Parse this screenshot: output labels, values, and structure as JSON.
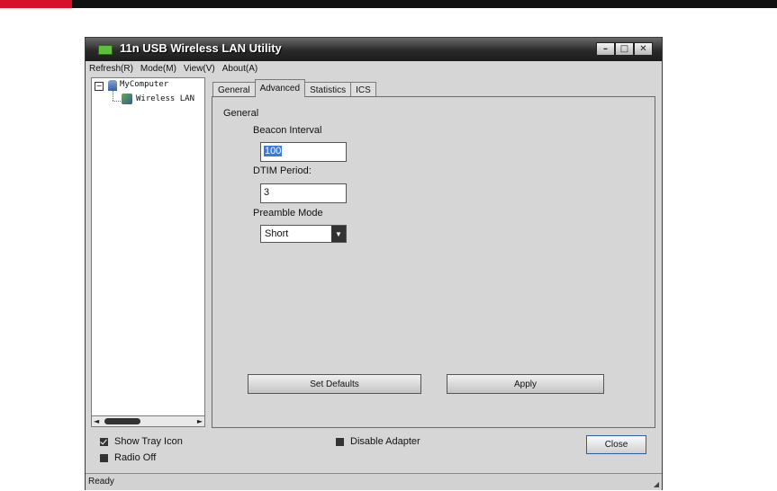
{
  "window": {
    "title": "11n USB Wireless LAN Utility",
    "controls": {
      "minimize": "–",
      "maximize": "□",
      "close": "✕"
    }
  },
  "menu": [
    {
      "label": "Refresh(R)"
    },
    {
      "label": "Mode(M)"
    },
    {
      "label": "View(V)"
    },
    {
      "label": "About(A)"
    }
  ],
  "tree": {
    "root": "MyComputer",
    "child": "Wireless LAN",
    "expander": "−"
  },
  "tabs": [
    {
      "label": "General"
    },
    {
      "label": "Advanced"
    },
    {
      "label": "Statistics"
    },
    {
      "label": "ICS"
    }
  ],
  "advanced": {
    "group_title": "General",
    "beacon_label": "Beacon Interval",
    "beacon_value": "100",
    "dtim_label": "DTIM Period:",
    "dtim_value": "3",
    "preamble_label": "Preamble Mode",
    "preamble_value": "Short",
    "set_defaults": "Set Defaults",
    "apply": "Apply"
  },
  "options": {
    "show_tray": "Show Tray Icon",
    "radio_off": "Radio Off",
    "disable_adapter": "Disable Adapter",
    "close": "Close"
  },
  "status": "Ready",
  "colors": {
    "accent_red": "#d4102a",
    "selection": "#3a7bd5"
  }
}
